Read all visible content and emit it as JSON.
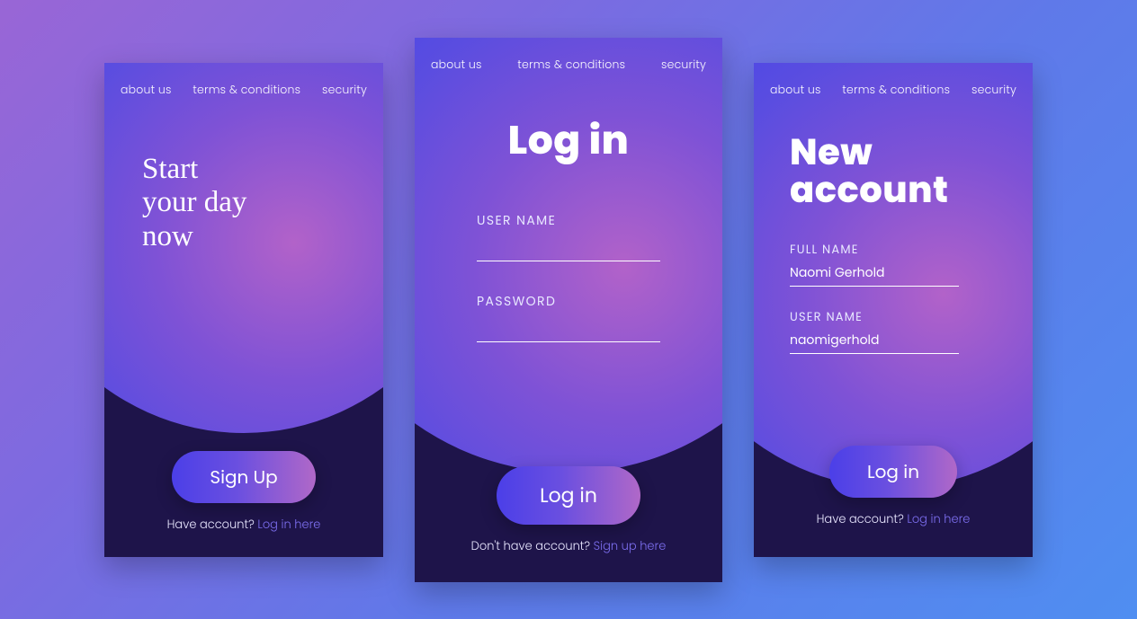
{
  "nav": {
    "about": "about us",
    "terms": "terms & conditions",
    "security": "security"
  },
  "card1": {
    "hero_line1": "Start",
    "hero_line2": "your day",
    "hero_line3": "now",
    "cta": "Sign Up",
    "sub_text": "Have account? ",
    "sub_link": "Log in here"
  },
  "card2": {
    "title": "Log in",
    "username_label": "USER NAME",
    "username_value": "",
    "password_label": "PASSWORD",
    "password_value": "",
    "cta": "Log in",
    "sub_text": "Don't have account? ",
    "sub_link": "Sign up here"
  },
  "card3": {
    "title_line1": "New",
    "title_line2": "account",
    "fullname_label": "FULL NAME",
    "fullname_value": "Naomi Gerhold",
    "username_label": "USER NAME",
    "username_value": "naomigerhold",
    "cta": "Log in",
    "sub_text": "Have account? ",
    "sub_link": "Log in here"
  }
}
